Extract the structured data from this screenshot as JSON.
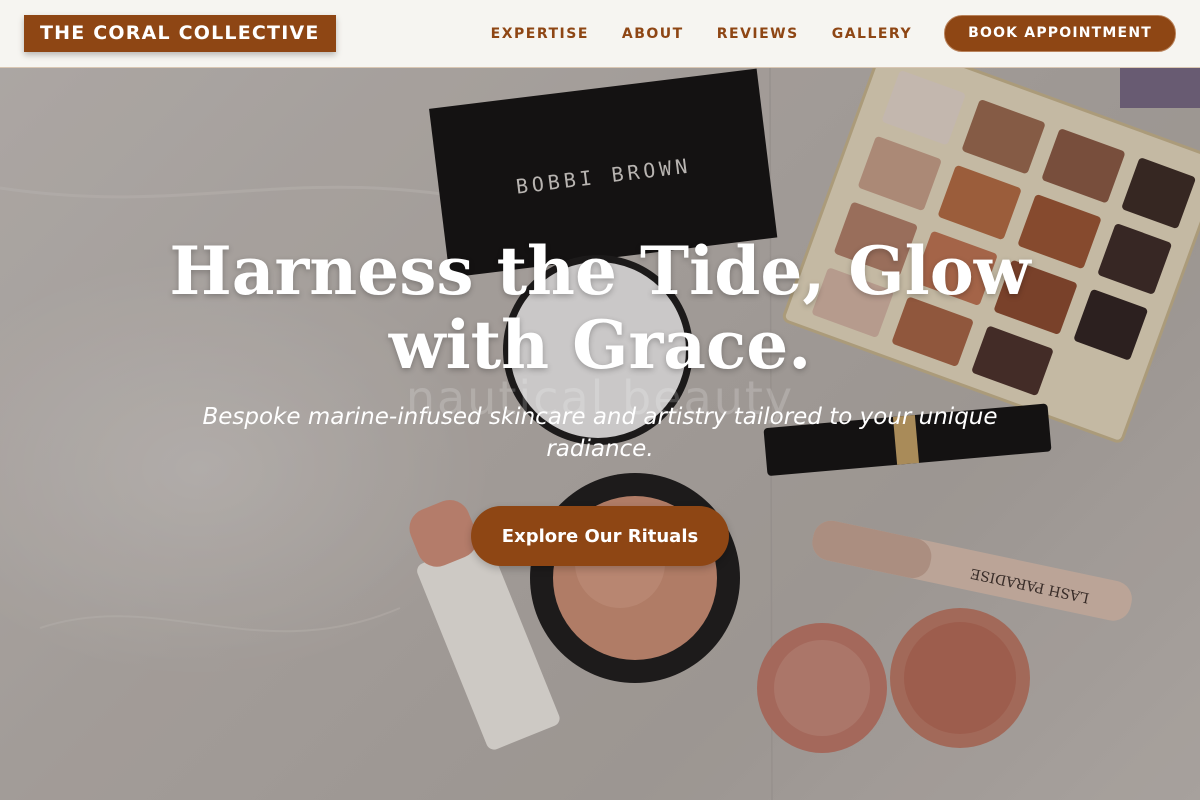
{
  "brand": {
    "name": "THE CORAL COLLECTIVE"
  },
  "nav": {
    "links": [
      "EXPERTISE",
      "ABOUT",
      "REVIEWS",
      "GALLERY"
    ],
    "cta": "BOOK APPOINTMENT"
  },
  "hero": {
    "headline": "Harness the Tide, Glow with Grace.",
    "ghost": "nautical beauty",
    "subline": "Bespoke marine-infused skincare and artistry tailored to your unique radiance.",
    "cta": "Explore Our Rituals",
    "photo_label": "BOBBI BROWN",
    "mascara_label": "LASH PARADISE"
  },
  "colors": {
    "accent": "#8e4614",
    "header_bg": "#f6f5f1",
    "text_light": "#ffffff"
  }
}
